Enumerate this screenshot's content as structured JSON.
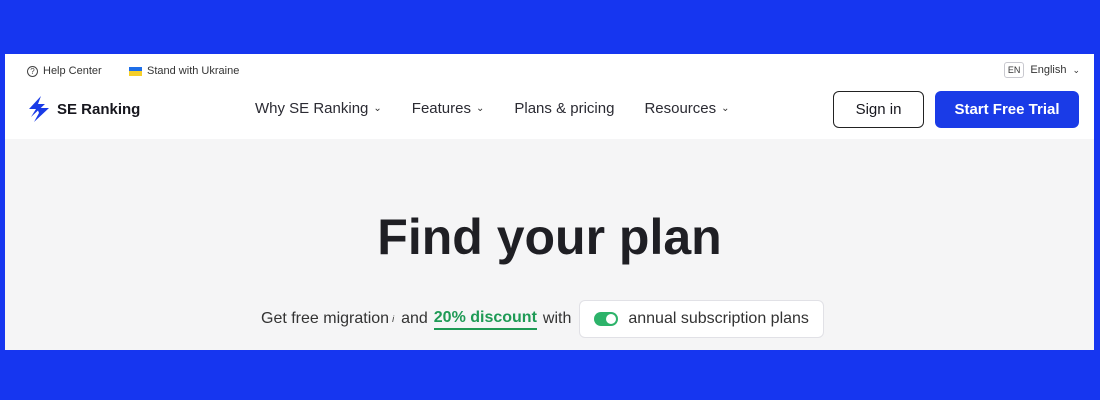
{
  "topbar": {
    "help_label": "Help Center",
    "ukraine_label": "Stand with Ukraine",
    "lang_code": "EN",
    "lang_label": "English"
  },
  "logo": {
    "text": "SE Ranking"
  },
  "nav": {
    "items": [
      {
        "label": "Why SE Ranking",
        "has_dropdown": true
      },
      {
        "label": "Features",
        "has_dropdown": true
      },
      {
        "label": "Plans & pricing",
        "has_dropdown": false
      },
      {
        "label": "Resources",
        "has_dropdown": true
      }
    ]
  },
  "actions": {
    "signin_label": "Sign in",
    "trial_label": "Start Free Trial"
  },
  "hero": {
    "title": "Find your plan",
    "promo_prefix": "Get free migration",
    "promo_info": "i",
    "promo_and": "and",
    "promo_discount": "20% discount",
    "promo_with": "with",
    "annual_label": "annual subscription plans",
    "annual_enabled": true
  },
  "colors": {
    "page_bg": "#1636f0",
    "primary": "#1a3be7",
    "success": "#1e9a55"
  },
  "icons": {
    "help": "question-circle-icon",
    "flag": "ukraine-flag-icon",
    "chevron": "chevron-down-icon",
    "logo": "se-ranking-logo-icon"
  }
}
